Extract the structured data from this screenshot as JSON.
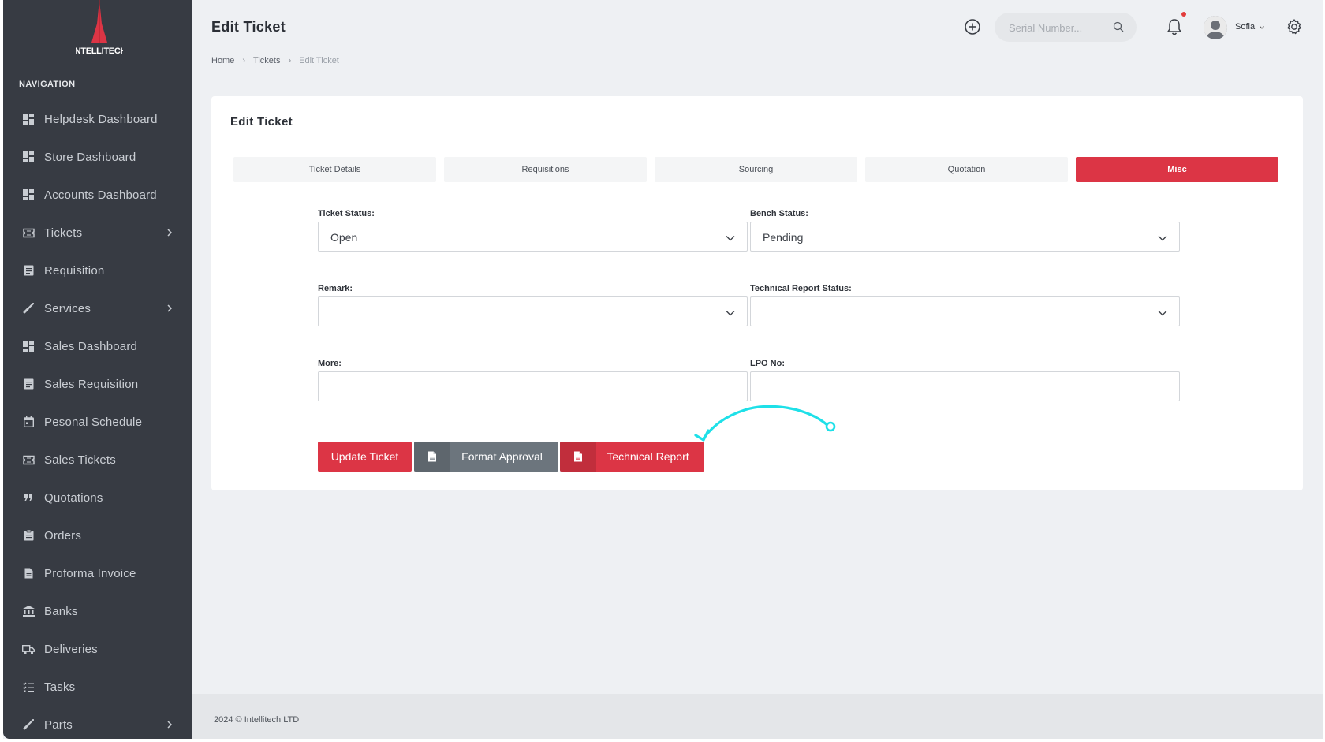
{
  "brand": {
    "logo_text": "INTELLITECH",
    "accent_color": "#dc3545"
  },
  "sidebar": {
    "section_title": "NAVIGATION",
    "items": [
      {
        "label": "Helpdesk Dashboard",
        "icon": "dashboard-icon",
        "has_submenu": false
      },
      {
        "label": "Store Dashboard",
        "icon": "dashboard-icon",
        "has_submenu": false
      },
      {
        "label": "Accounts Dashboard",
        "icon": "dashboard-icon",
        "has_submenu": false
      },
      {
        "label": "Tickets",
        "icon": "ticket-icon",
        "has_submenu": true
      },
      {
        "label": "Requisition",
        "icon": "list-icon",
        "has_submenu": false
      },
      {
        "label": "Services",
        "icon": "wrench-icon",
        "has_submenu": true
      },
      {
        "label": "Sales Dashboard",
        "icon": "dashboard-icon",
        "has_submenu": false
      },
      {
        "label": "Sales Requisition",
        "icon": "list-icon",
        "has_submenu": false
      },
      {
        "label": "Pesonal Schedule",
        "icon": "calendar-icon",
        "has_submenu": false
      },
      {
        "label": "Sales Tickets",
        "icon": "ticket-icon",
        "has_submenu": false
      },
      {
        "label": "Quotations",
        "icon": "quote-icon",
        "has_submenu": false
      },
      {
        "label": "Orders",
        "icon": "clipboard-icon",
        "has_submenu": false
      },
      {
        "label": "Proforma Invoice",
        "icon": "document-icon",
        "has_submenu": false
      },
      {
        "label": "Banks",
        "icon": "bank-icon",
        "has_submenu": false
      },
      {
        "label": "Deliveries",
        "icon": "truck-icon",
        "has_submenu": false
      },
      {
        "label": "Tasks",
        "icon": "tasks-icon",
        "has_submenu": false
      },
      {
        "label": "Parts",
        "icon": "wrench-icon",
        "has_submenu": true
      }
    ]
  },
  "header": {
    "title": "Edit Ticket",
    "breadcrumb": [
      "Home",
      "Tickets",
      "Edit Ticket"
    ],
    "search_placeholder": "Serial Number...",
    "user_name": "Sofia",
    "has_notification": true
  },
  "card": {
    "title": "Edit Ticket",
    "tabs": [
      {
        "label": "Ticket Details",
        "active": false
      },
      {
        "label": "Requisitions",
        "active": false
      },
      {
        "label": "Sourcing",
        "active": false
      },
      {
        "label": "Quotation",
        "active": false
      },
      {
        "label": "Misc",
        "active": true
      }
    ],
    "fields": {
      "ticket_status": {
        "label": "Ticket Status:",
        "value": "Open"
      },
      "bench_status": {
        "label": "Bench Status:",
        "value": "Pending"
      },
      "remark": {
        "label": "Remark:",
        "value": ""
      },
      "technical_report_status": {
        "label": "Technical Report Status:",
        "value": ""
      },
      "more": {
        "label": "More:",
        "value": ""
      },
      "lpo_no": {
        "label": "LPO No:",
        "value": ""
      }
    },
    "buttons": {
      "update": "Update Ticket",
      "format_approval": "Format Approval",
      "technical_report": "Technical Report"
    }
  },
  "annotation": {
    "arrow_color": "#1ee0e8"
  },
  "footer": {
    "text": "2024 © Intellitech LTD"
  }
}
